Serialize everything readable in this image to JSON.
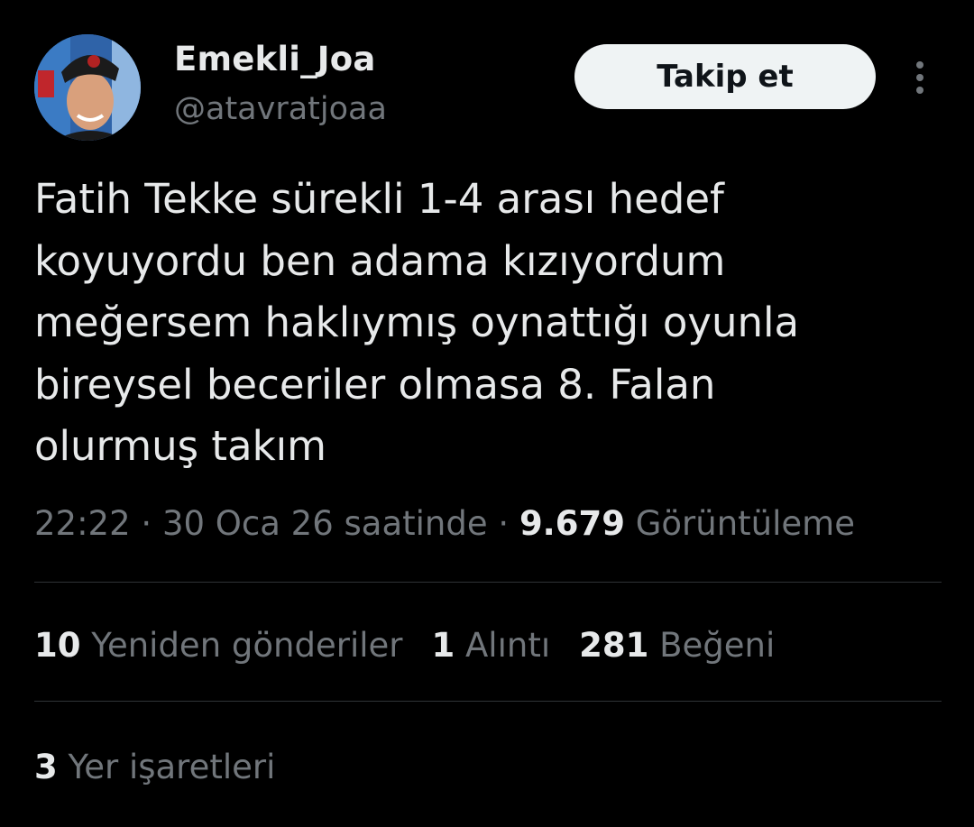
{
  "author": {
    "display_name": "Emekli_Joa",
    "handle": "@atavratjoaa"
  },
  "actions": {
    "follow_label": "Takip et",
    "more_icon": "more-vertical-icon"
  },
  "tweet": {
    "text_lines": [
      "Fatih Tekke sürekli 1-4 arası hedef",
      "koyuyordu ben adama kızıyordum",
      "meğersem haklıymış oynattığı oyunla",
      "bireysel beceriler olmasa 8. Falan",
      "olurmuş takım"
    ]
  },
  "meta": {
    "time": "22:22",
    "separator": " · ",
    "date": "30 Oca 26 saatinde",
    "views_count": "9.679",
    "views_label": "Görüntüleme"
  },
  "stats": {
    "reposts": {
      "count": "10",
      "label": "Yeniden gönderiler"
    },
    "quotes": {
      "count": "1",
      "label": "Alıntı"
    },
    "likes": {
      "count": "281",
      "label": "Beğeni"
    }
  },
  "bookmarks": {
    "count": "3",
    "label": "Yer işaretleri"
  },
  "colors": {
    "background": "#000000",
    "primary_text": "#e7e9ea",
    "secondary_text": "#71767b",
    "divider": "#2f3336",
    "button_bg": "#eff3f4"
  }
}
